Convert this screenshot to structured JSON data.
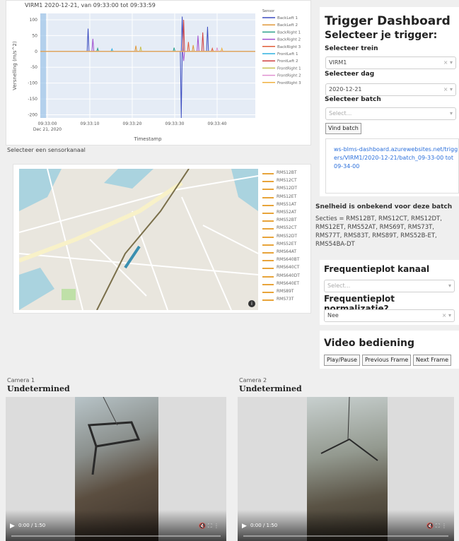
{
  "chart": {
    "title": "VIRM1 2020-12-21, van 09:33:00 tot 09:33:59",
    "ylabel": "Versnelling (m/s^2)",
    "xlabel": "Timestamp",
    "legend_title": "Sensor",
    "date_label": "Dec 21, 2020"
  },
  "chart_data": {
    "type": "line",
    "title": "VIRM1 2020-12-21, van 09:33:00 tot 09:33:59",
    "xlabel": "Timestamp",
    "ylabel": "Versnelling (m/s^2)",
    "x_ticks": [
      "09:33:00",
      "09:33:10",
      "09:33:20",
      "09:33:30",
      "09:33:40"
    ],
    "y_ticks": [
      100,
      50,
      0,
      -50,
      -100,
      -150,
      -200
    ],
    "ylim": [
      -210,
      120
    ],
    "series": [
      {
        "name": "BackLeft 1",
        "color": "#3b4cc0",
        "spikes": [
          [
            10,
            72
          ],
          [
            29.5,
            -210
          ],
          [
            29.7,
            110
          ],
          [
            35,
            78
          ]
        ]
      },
      {
        "name": "BackLeft 2",
        "color": "#e0983a",
        "spikes": [
          [
            20,
            18
          ],
          [
            32,
            20
          ]
        ]
      },
      {
        "name": "BackRight 1",
        "color": "#2aa08a",
        "spikes": [
          [
            12,
            10
          ],
          [
            28,
            12
          ]
        ]
      },
      {
        "name": "BackRight 2",
        "color": "#a14fd0",
        "spikes": [
          [
            11,
            40
          ],
          [
            33,
            50
          ],
          [
            30,
            -30
          ]
        ]
      },
      {
        "name": "BackRight 3",
        "color": "#e05c3a",
        "spikes": [
          [
            31,
            30
          ],
          [
            36,
            10
          ]
        ]
      },
      {
        "name": "FrontLeft 1",
        "color": "#2fb0e0",
        "spikes": [
          [
            15,
            8
          ]
        ]
      },
      {
        "name": "FrontLeft 2",
        "color": "#d04040",
        "spikes": [
          [
            30,
            100
          ],
          [
            34,
            60
          ]
        ]
      },
      {
        "name": "FrontRight 1",
        "color": "#c8c050",
        "spikes": [
          [
            21,
            15
          ]
        ]
      },
      {
        "name": "FrontRight 2",
        "color": "#e090d0",
        "spikes": [
          [
            37,
            12
          ]
        ]
      },
      {
        "name": "FrontRight 3",
        "color": "#f0b040",
        "spikes": [
          [
            38,
            10
          ]
        ]
      }
    ]
  },
  "sensor_label": "Selecteer een sensorkanaal",
  "map": {
    "sensors": [
      "RMS12BT",
      "RMS12CT",
      "RMS12DT",
      "RMS12ET",
      "RMS51AT",
      "RMS52AT",
      "RMS52BT",
      "RMS52CT",
      "RMS52DT",
      "RMS52ET",
      "RMS64AT",
      "RMS640BT",
      "RMS640CT",
      "RMS640DT",
      "RMS640ET",
      "RMS89T",
      "RMS73T"
    ],
    "sensor_color": "#e8a43a"
  },
  "side": {
    "title": "Trigger Dashboard",
    "subtitle": "Selecteer je trigger:",
    "train_label": "Selecteer trein",
    "train_value": "VIRM1",
    "day_label": "Selecteer dag",
    "day_value": "2020-12-21",
    "batch_label": "Selecteer batch",
    "batch_placeholder": "Select...",
    "find_button": "Vind batch",
    "link": "ws-blms-dashboard.azurewebsites.net/triggers/VIRM1/2020-12-21/batch_09-33-00 tot 09-34-00",
    "speed_note": "Snelheid is onbekend voor deze batch",
    "sections": "Secties = RMS12BT, RMS12CT, RMS12DT, RMS12ET, RMS52AT, RMS69T, RMS73T, RMS77T, RMS83T, RMS89T, RMS52B-ET, RMS54BA-DT"
  },
  "freq": {
    "title": "Frequentieplot kanaal",
    "placeholder": "Select...",
    "norm_title": "Frequentieplot normalizatie?",
    "norm_value": "Nee"
  },
  "video": {
    "title": "Video bediening",
    "play": "Play/Pause",
    "prev": "Previous Frame",
    "next": "Next Frame"
  },
  "cameras": [
    {
      "label": "Camera 1",
      "title": "Undetermined",
      "time": "0:00 / 1:50"
    },
    {
      "label": "Camera 2",
      "title": "Undetermined",
      "time": "0:00 / 1:50"
    }
  ],
  "icons": {
    "ctl": "× ▾",
    "play": "▶",
    "vicons": "🔇  ⛶  ⋮",
    "info": "i"
  }
}
